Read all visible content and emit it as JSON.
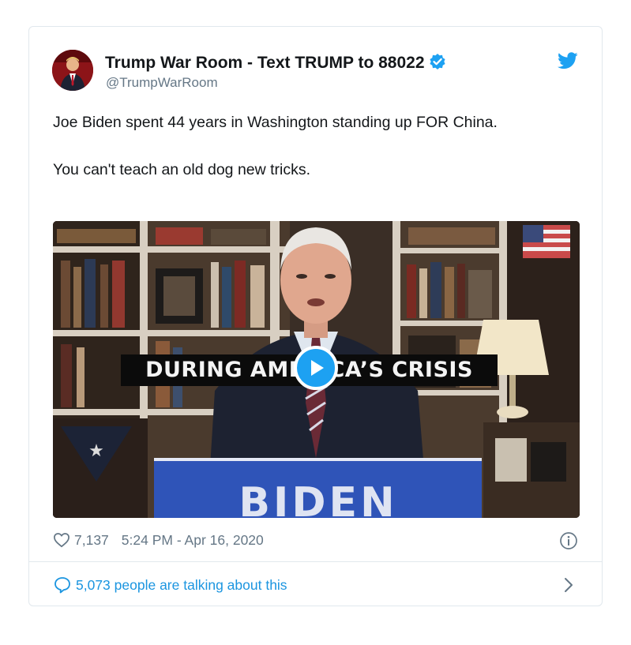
{
  "tweet": {
    "display_name": "Trump War Room - Text TRUMP to 88022",
    "handle": "@TrumpWarRoom",
    "paragraphs": [
      "Joe Biden spent 44 years in Washington standing up FOR China.",
      "You can't teach an old dog new tricks."
    ],
    "video_caption": "DURING AMERICA’S CRISIS",
    "podium_text": "BIDEN",
    "likes": "7,137",
    "timestamp": "5:24 PM - Apr 16, 2020",
    "conversation": "5,073 people are talking about this"
  },
  "icons": {
    "verified": "verified-badge-icon",
    "brand": "twitter-bird-icon",
    "like": "heart-icon",
    "info": "info-icon",
    "reply": "speech-bubble-icon",
    "play": "play-icon",
    "chevron": "chevron-right-icon"
  },
  "colors": {
    "accent": "#1da1f2",
    "link": "#1b95e0",
    "muted": "#657786",
    "text": "#14171a",
    "border": "#e1e8ed"
  }
}
